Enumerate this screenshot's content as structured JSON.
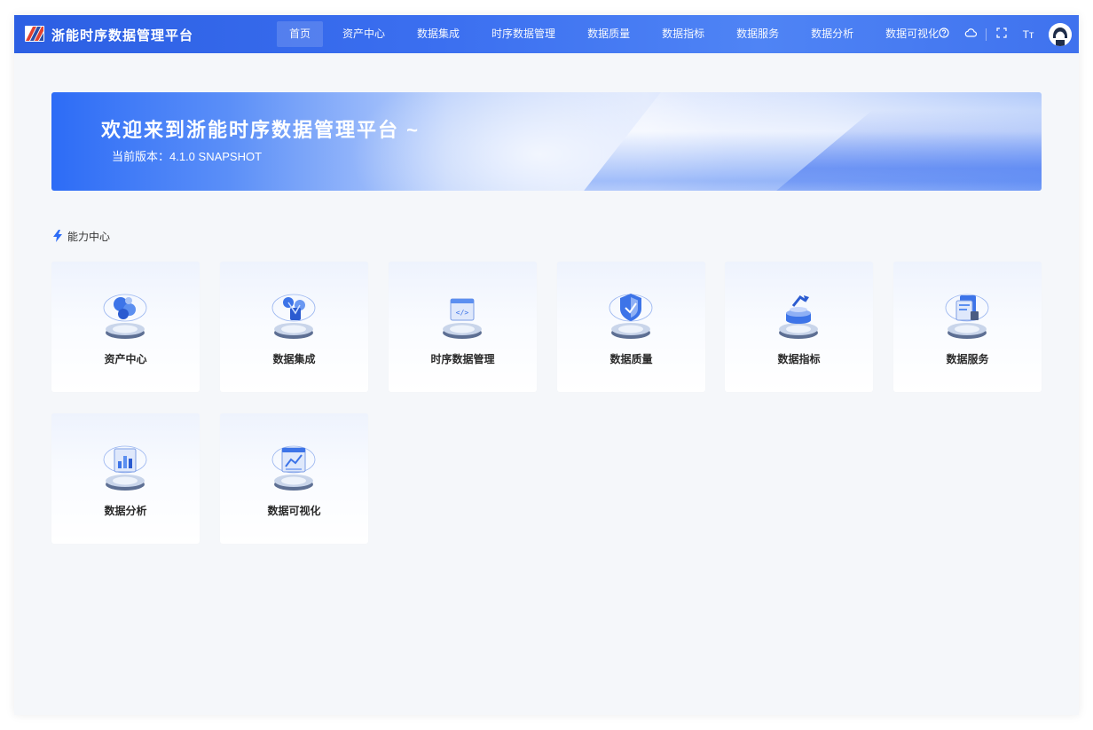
{
  "header": {
    "brand": "浙能时序数据管理平台",
    "nav": [
      {
        "label": "首页",
        "active": true
      },
      {
        "label": "资产中心"
      },
      {
        "label": "数据集成"
      },
      {
        "label": "时序数据管理"
      },
      {
        "label": "数据质量"
      },
      {
        "label": "数据指标"
      },
      {
        "label": "数据服务"
      },
      {
        "label": "数据分析"
      },
      {
        "label": "数据可视化"
      }
    ],
    "tools": {
      "font_size_label": "Tт"
    }
  },
  "banner": {
    "title": "欢迎来到浙能时序数据管理平台 ~",
    "version": "当前版本：4.1.0 SNAPSHOT"
  },
  "section": {
    "title": "能力中心"
  },
  "cards": [
    {
      "label": "资产中心",
      "icon": "asset-center-icon"
    },
    {
      "label": "数据集成",
      "icon": "data-integration-icon"
    },
    {
      "label": "时序数据管理",
      "icon": "timeseries-management-icon"
    },
    {
      "label": "数据质量",
      "icon": "data-quality-icon"
    },
    {
      "label": "数据指标",
      "icon": "data-metrics-icon"
    },
    {
      "label": "数据服务",
      "icon": "data-service-icon"
    },
    {
      "label": "数据分析",
      "icon": "data-analysis-icon"
    },
    {
      "label": "数据可视化",
      "icon": "data-visualization-icon"
    }
  ],
  "colors": {
    "header": "#3b6ff0",
    "accent": "#2d6cf6",
    "background": "#f5f7fa"
  }
}
